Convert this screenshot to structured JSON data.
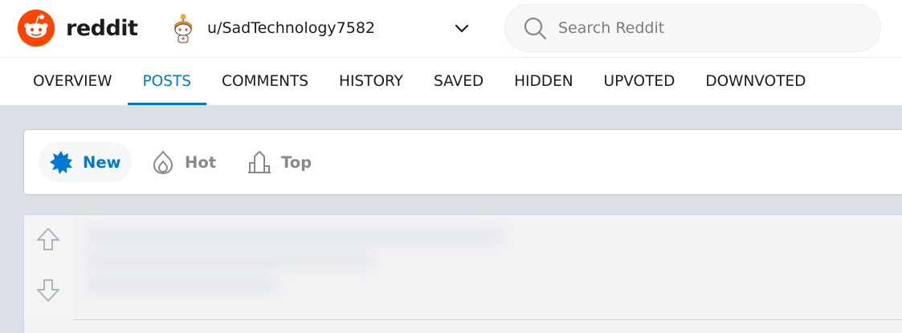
{
  "brand": {
    "name": "reddit",
    "accent": "#ff4500"
  },
  "user": {
    "name": "u/SadTechnology7582"
  },
  "search": {
    "placeholder": "Search Reddit"
  },
  "tabs": [
    {
      "label": "OVERVIEW",
      "active": false
    },
    {
      "label": "POSTS",
      "active": true
    },
    {
      "label": "COMMENTS",
      "active": false
    },
    {
      "label": "HISTORY",
      "active": false
    },
    {
      "label": "SAVED",
      "active": false
    },
    {
      "label": "HIDDEN",
      "active": false
    },
    {
      "label": "UPVOTED",
      "active": false
    },
    {
      "label": "DOWNVOTED",
      "active": false
    }
  ],
  "sort": {
    "new_label": "New",
    "hot_label": "Hot",
    "top_label": "Top",
    "selected": "New"
  },
  "colors": {
    "link_blue": "#0079d3",
    "muted": "#878a8c",
    "background": "#dae0e6"
  },
  "icons": {
    "logo": "reddit-snoo-icon",
    "avatar": "user-avatar-icon",
    "chevron": "chevron-down-icon",
    "search": "search-icon",
    "new": "starburst-icon",
    "hot": "flame-icon",
    "top": "rising-bars-icon",
    "upvote": "arrow-up-icon",
    "downvote": "arrow-down-icon"
  }
}
